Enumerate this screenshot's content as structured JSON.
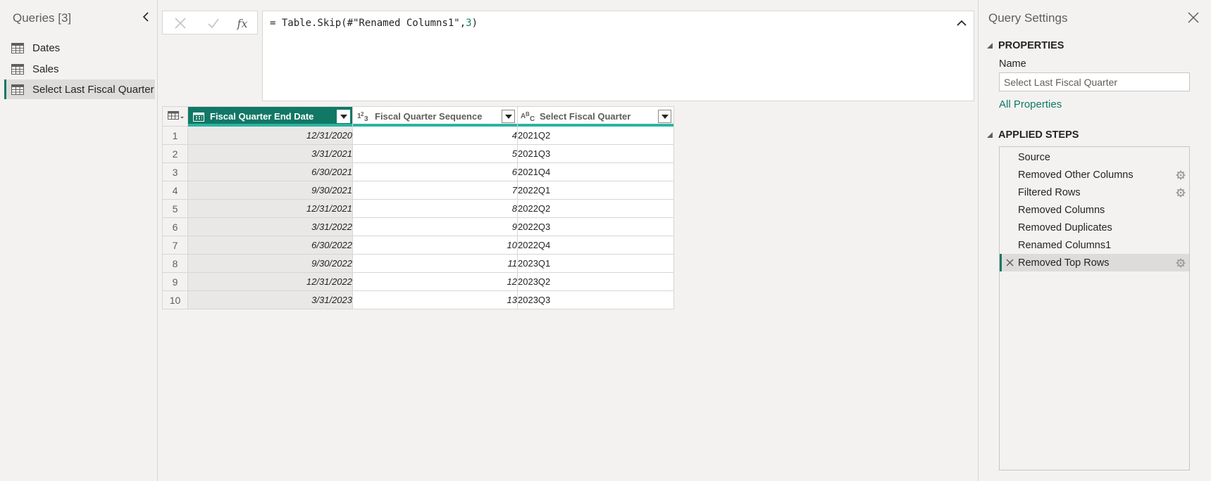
{
  "queries_pane": {
    "title": "Queries [3]",
    "items": [
      {
        "label": "Dates",
        "icon": "table-icon",
        "selected": false
      },
      {
        "label": "Sales",
        "icon": "table-icon",
        "selected": false
      },
      {
        "label": "Select Last Fiscal Quarter",
        "icon": "table-icon",
        "selected": true
      }
    ]
  },
  "formula_bar": {
    "cancel_icon": "x-icon",
    "commit_icon": "check-icon",
    "fx_label": "fx",
    "formula_prefix": "= Table.Skip(#\"Renamed Columns1\",",
    "formula_number": "3",
    "formula_suffix": ")"
  },
  "grid": {
    "columns": [
      {
        "name": "Fiscal Quarter End Date",
        "type_icon": "date-type-icon",
        "selected": true
      },
      {
        "name": "Fiscal Quarter Sequence",
        "type_label": "1²3",
        "type_icon": "number-type-icon",
        "selected": false
      },
      {
        "name": "Select Fiscal Quarter",
        "type_label": "ABC",
        "type_icon": "text-type-icon",
        "selected": false
      }
    ],
    "rows": [
      {
        "n": "1",
        "date": "12/31/2020",
        "seq": "4",
        "q": "2021Q2"
      },
      {
        "n": "2",
        "date": "3/31/2021",
        "seq": "5",
        "q": "2021Q3"
      },
      {
        "n": "3",
        "date": "6/30/2021",
        "seq": "6",
        "q": "2021Q4"
      },
      {
        "n": "4",
        "date": "9/30/2021",
        "seq": "7",
        "q": "2022Q1"
      },
      {
        "n": "5",
        "date": "12/31/2021",
        "seq": "8",
        "q": "2022Q2"
      },
      {
        "n": "6",
        "date": "3/31/2022",
        "seq": "9",
        "q": "2022Q3"
      },
      {
        "n": "7",
        "date": "6/30/2022",
        "seq": "10",
        "q": "2022Q4"
      },
      {
        "n": "8",
        "date": "9/30/2022",
        "seq": "11",
        "q": "2023Q1"
      },
      {
        "n": "9",
        "date": "12/31/2022",
        "seq": "12",
        "q": "2023Q2"
      },
      {
        "n": "10",
        "date": "3/31/2023",
        "seq": "13",
        "q": "2023Q3"
      }
    ]
  },
  "query_settings": {
    "title": "Query Settings",
    "properties_header": "PROPERTIES",
    "name_label": "Name",
    "name_value": "Select Last Fiscal Quarter",
    "all_properties_link": "All Properties",
    "applied_steps_header": "APPLIED STEPS",
    "steps": [
      {
        "label": "Source",
        "gear": false,
        "selected": false
      },
      {
        "label": "Removed Other Columns",
        "gear": true,
        "selected": false
      },
      {
        "label": "Filtered Rows",
        "gear": true,
        "selected": false
      },
      {
        "label": "Removed Columns",
        "gear": false,
        "selected": false
      },
      {
        "label": "Removed Duplicates",
        "gear": false,
        "selected": false
      },
      {
        "label": "Renamed Columns1",
        "gear": false,
        "selected": false
      },
      {
        "label": "Removed Top Rows",
        "gear": true,
        "selected": true
      }
    ]
  },
  "colors": {
    "accent": "#117865",
    "quality_bar": "#2bb3a3",
    "formula_number": "#098658"
  }
}
